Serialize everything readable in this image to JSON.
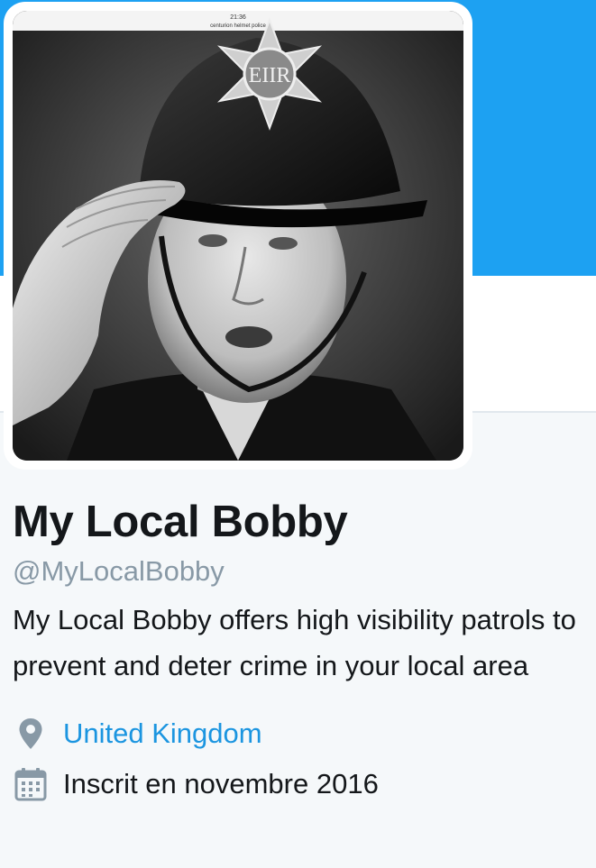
{
  "profile": {
    "display_name": "My Local Bobby",
    "screen_name": "@MyLocalBobby",
    "bio": "My Local Bobby offers high visibility patrols to prevent and deter crime in your local area",
    "location": "United Kingdom",
    "joined": "Inscrit en novembre 2016",
    "avatar": {
      "caption_time": "21:36",
      "caption_search": "centurion helmet police",
      "badge_text": "EIIR",
      "description": "black and white portrait of a saluting police officer in a custodian helmet"
    }
  },
  "icons": {
    "location": "map-pin-icon",
    "joined": "calendar-icon"
  },
  "colors": {
    "banner": "#1da1f2",
    "link": "#1b95e0",
    "muted": "#8899a6",
    "text": "#14171a",
    "background": "#f5f8fa"
  }
}
